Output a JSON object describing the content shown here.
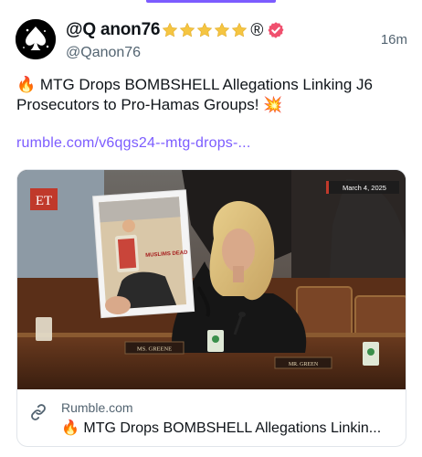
{
  "post": {
    "display_name": "@Q anon76",
    "handle": "@Qanon76",
    "timestamp": "16m",
    "star_count": 5,
    "registered_mark": "®",
    "text_emoji": "🔥",
    "text": "MTG Drops BOMBSHELL Allegations Linking J6 Prosecutors to Pro-Hamas Groups!",
    "text_end_emoji": "💥",
    "link": "rumble.com/v6qgs24--mtg-drops-..."
  },
  "embed": {
    "video_badge": "ET",
    "video_date": "March 4, 2025",
    "sign_text": "MUSLIMS DEAD",
    "nameplate_left": "MS. GREENE",
    "nameplate_right": "MR. GREEN",
    "domain": "Rumble.com",
    "title_emoji": "🔥",
    "title": "MTG Drops BOMBSHELL Allegations Linkin..."
  },
  "colors": {
    "accent": "#7c5cff",
    "verified": "#f0506e",
    "star": "#f5c542",
    "muted": "#536471"
  },
  "icons": [
    "avatar-spade-icon",
    "star-icon",
    "registered-icon",
    "verified-badge-icon",
    "link-chain-icon"
  ]
}
